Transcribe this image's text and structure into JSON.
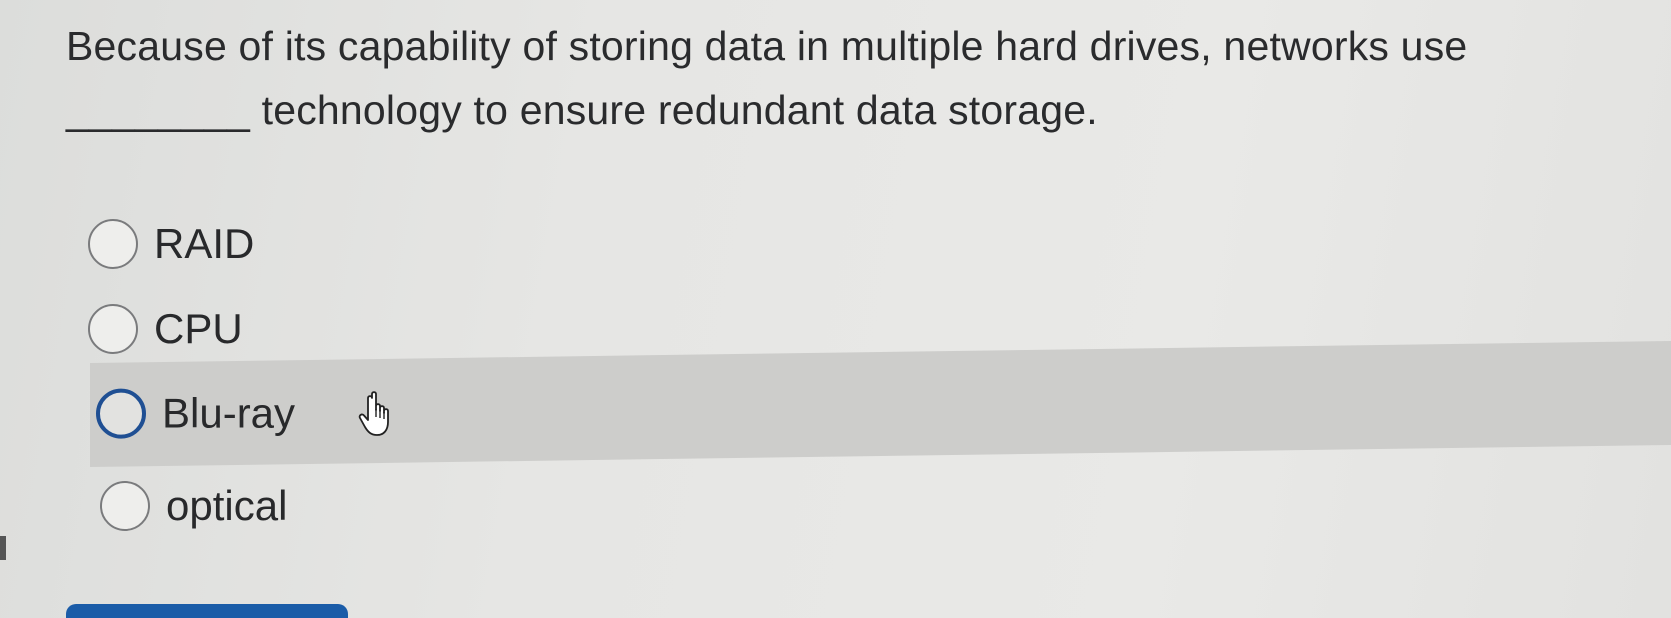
{
  "question": {
    "line1": "Because of its capability of storing data in multiple hard drives, networks use",
    "blank": "________",
    "line2": " technology to ensure redundant data storage."
  },
  "options": [
    {
      "label": "RAID",
      "hovered": false
    },
    {
      "label": "CPU",
      "hovered": false
    },
    {
      "label": "Blu-ray",
      "hovered": true
    },
    {
      "label": "optical",
      "hovered": false
    }
  ],
  "colors": {
    "hover_row": "#cdcdcb",
    "focus_ring": "#1f4f93",
    "primary_button": "#1a5ca8"
  },
  "icons": {
    "pointer": "hand-pointer-icon"
  }
}
